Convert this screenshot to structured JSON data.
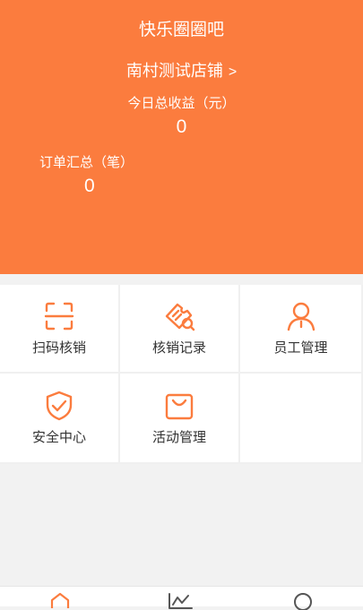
{
  "header": {
    "app_title": "快乐圈圈吧",
    "store_name": "南村测试店铺",
    "store_chevron": ">",
    "revenue_label": "今日总收益（元）",
    "revenue_value": "0",
    "orders_label": "订单汇总（笔）",
    "orders_value": "0"
  },
  "menu": [
    {
      "label": "扫码核销",
      "icon": "scan-icon"
    },
    {
      "label": "核销记录",
      "icon": "ticket-icon"
    },
    {
      "label": "员工管理",
      "icon": "user-icon"
    },
    {
      "label": "安全中心",
      "icon": "shield-icon"
    },
    {
      "label": "活动管理",
      "icon": "bag-icon"
    }
  ],
  "tabbar": [
    {
      "icon": "home-icon"
    },
    {
      "icon": "chart-icon"
    },
    {
      "icon": "profile-icon"
    }
  ],
  "colors": {
    "accent": "#fb7c3e",
    "background": "#f2f2f2",
    "text": "#333333"
  }
}
